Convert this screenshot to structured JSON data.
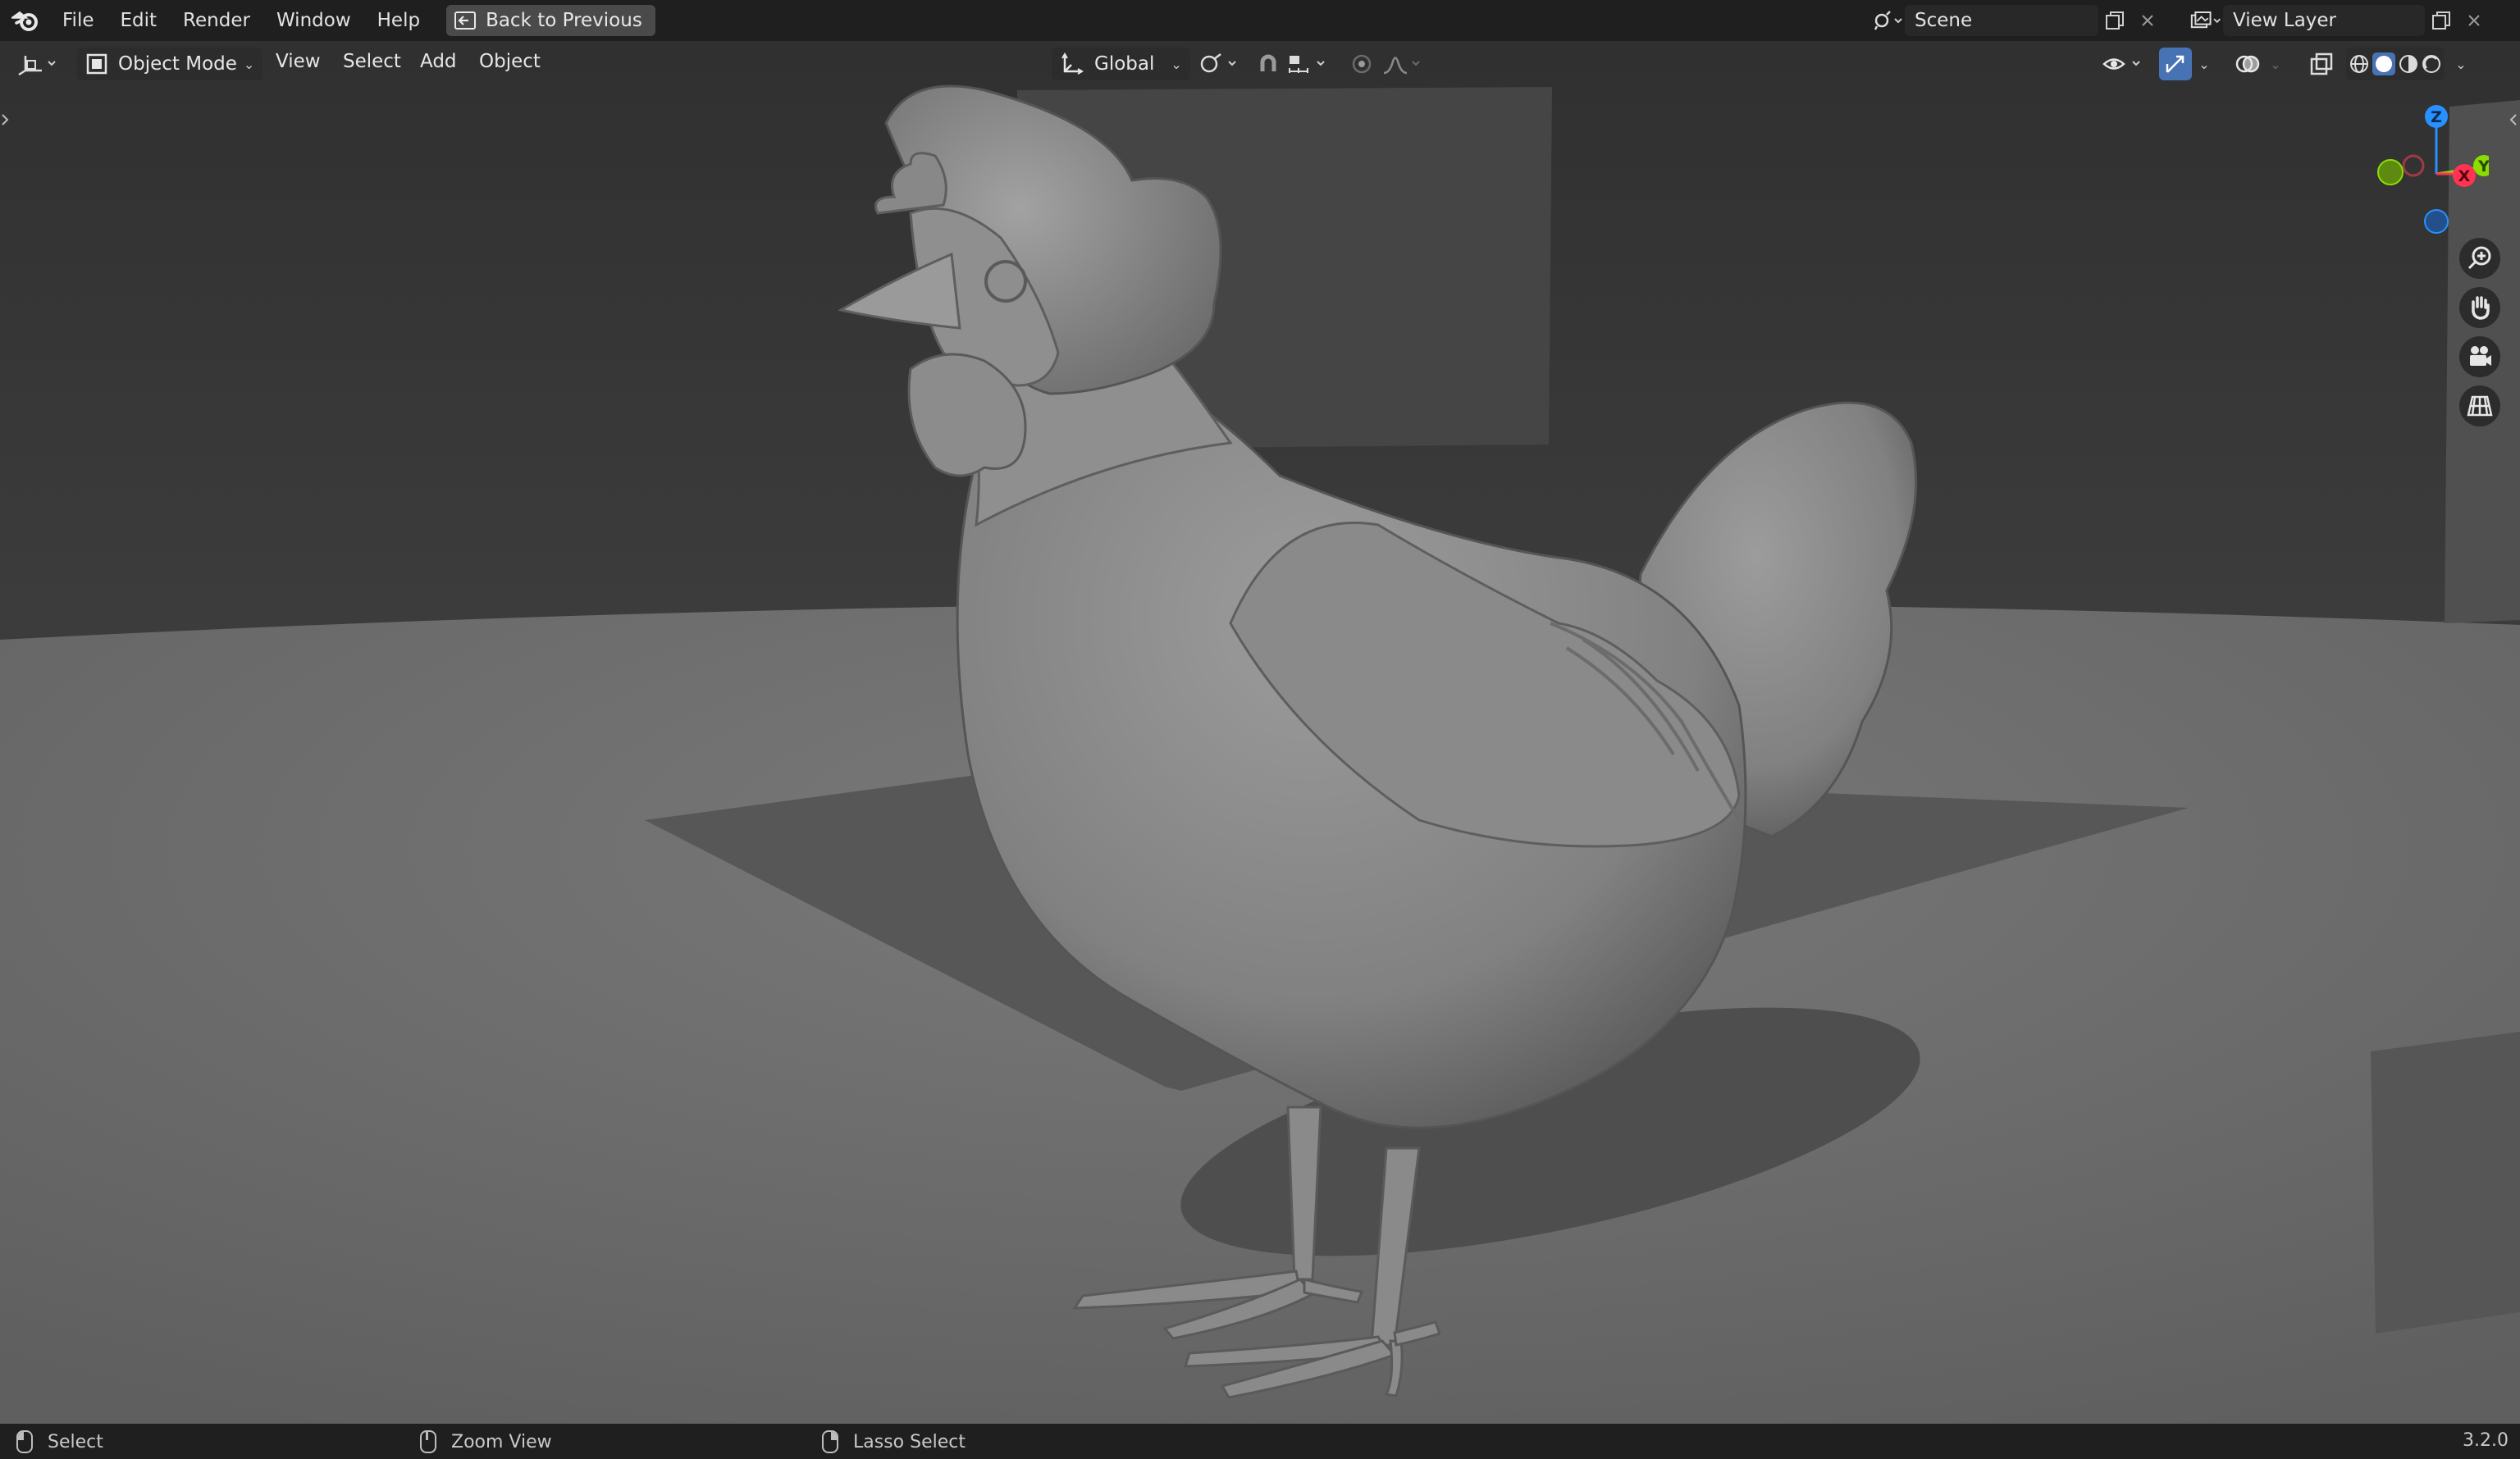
{
  "menu": {
    "items": [
      "File",
      "Edit",
      "Render",
      "Window",
      "Help"
    ],
    "back_button": "Back to Previous"
  },
  "scene": {
    "label": "Scene"
  },
  "view_layer": {
    "label": "View Layer"
  },
  "viewport_header": {
    "mode": "Object Mode",
    "menus": [
      "View",
      "Select",
      "Add",
      "Object"
    ],
    "transform_orientation": "Global"
  },
  "gizmo": {
    "z": "Z",
    "x": "X",
    "y": "Y"
  },
  "statusbar": {
    "left": "Select",
    "middle": "Zoom View",
    "right": "Lasso Select",
    "version": "3.2.0"
  },
  "colors": {
    "accent": "#4772b3",
    "x_axis": "#ff3352",
    "y_axis": "#8bdc00",
    "z_axis": "#2890ff"
  }
}
